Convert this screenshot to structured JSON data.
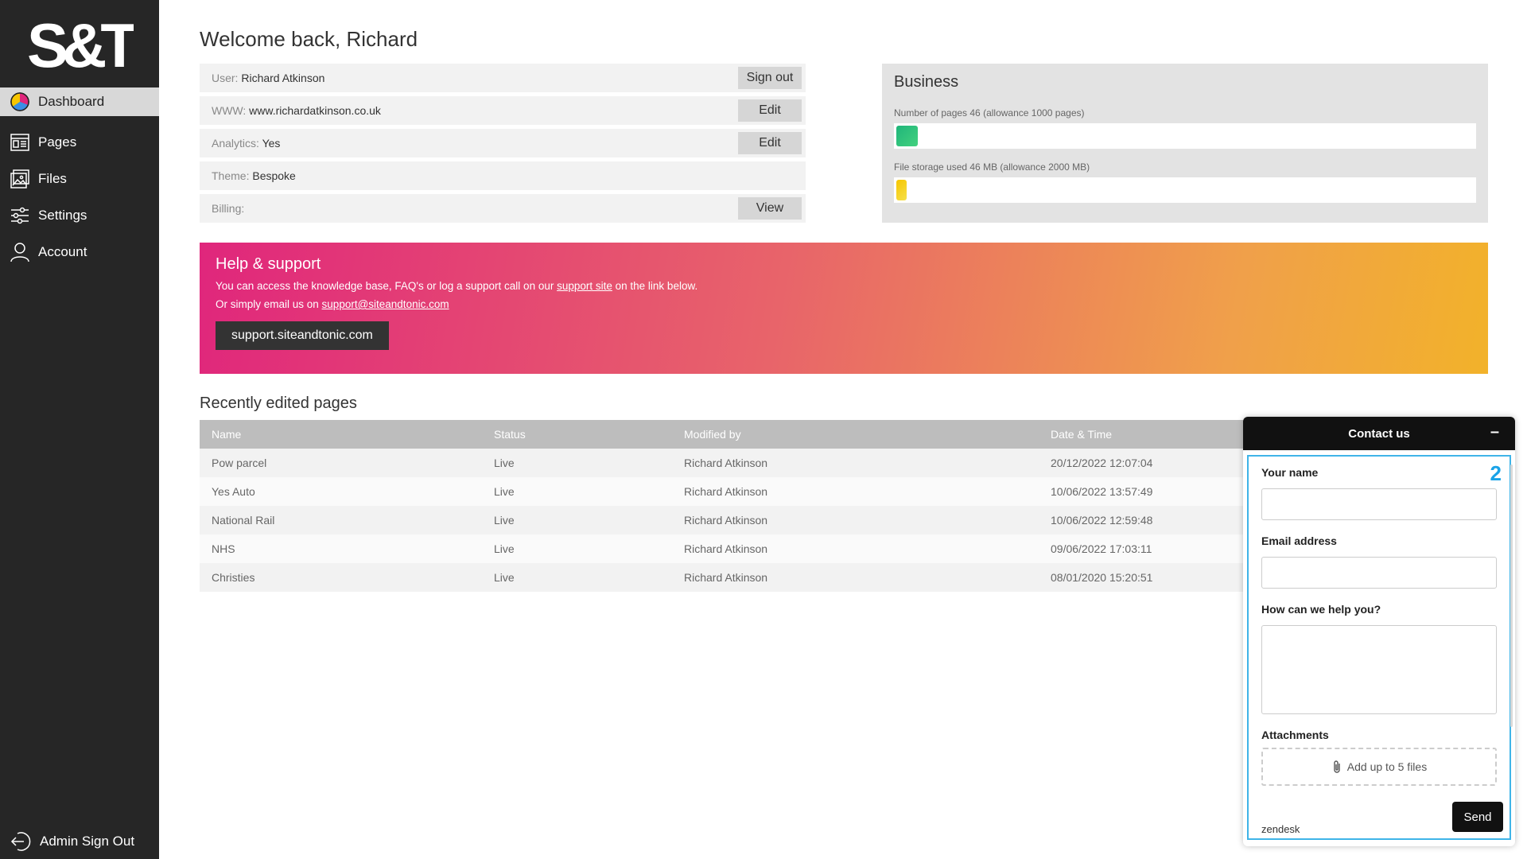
{
  "sidebar": {
    "logo_text": "S&T",
    "items": [
      {
        "label": "Dashboard",
        "icon": "dashboard-icon"
      },
      {
        "label": "Pages",
        "icon": "pages-icon"
      },
      {
        "label": "Files",
        "icon": "files-icon"
      },
      {
        "label": "Settings",
        "icon": "settings-icon"
      },
      {
        "label": "Account",
        "icon": "account-icon"
      }
    ],
    "admin_sign_out": "Admin Sign Out"
  },
  "main": {
    "welcome": "Welcome back, Richard",
    "info": [
      {
        "label": "User:",
        "value": "Richard Atkinson",
        "button": "Sign out"
      },
      {
        "label": "WWW:",
        "value": "www.richardatkinson.co.uk",
        "button": "Edit"
      },
      {
        "label": "Analytics:",
        "value": "Yes",
        "button": "Edit"
      },
      {
        "label": "Theme:",
        "value": "Bespoke",
        "button": ""
      },
      {
        "label": "Billing:",
        "value": "",
        "button": "View"
      }
    ],
    "business": {
      "title": "Business",
      "pages_usage": "Number of pages 46 (allowance 1000 pages)",
      "pages_fraction": 0.046,
      "storage_usage": "File storage used 46 MB (allowance 2000 MB)",
      "storage_fraction": 0.023
    },
    "help": {
      "title": "Help & support",
      "line1_pre": "You can access the knowledge base, FAQ's or log a support call on our ",
      "line1_link": "support site",
      "line1_post": " on the link below.",
      "line2_pre": "Or simply email us on ",
      "line2_link": "support@siteandtonic.com",
      "button": "support.siteandtonic.com"
    },
    "recent": {
      "title": "Recently edited pages",
      "columns": [
        "Name",
        "Status",
        "Modified by",
        "Date & Time"
      ],
      "rows": [
        [
          "Pow parcel",
          "Live",
          "Richard Atkinson",
          "20/12/2022 12:07:04"
        ],
        [
          "Yes Auto",
          "Live",
          "Richard Atkinson",
          "10/06/2022 13:57:49"
        ],
        [
          "National Rail",
          "Live",
          "Richard Atkinson",
          "10/06/2022 12:59:48"
        ],
        [
          "NHS",
          "Live",
          "Richard Atkinson",
          "09/06/2022 17:03:11"
        ],
        [
          "Christies",
          "Live",
          "Richard Atkinson",
          "08/01/2020 15:20:51"
        ]
      ]
    }
  },
  "contact": {
    "title": "Contact us",
    "minimize": "–",
    "step": "2",
    "name_label": "Your name",
    "email_label": "Email address",
    "help_label": "How can we help you?",
    "attachments_label": "Attachments",
    "attach_text": "Add up to 5 files",
    "brand": "zendesk",
    "send": "Send"
  },
  "colors": {
    "sidebar_bg": "#262626",
    "accent_blue": "#3fb4e8",
    "help_gradient_start": "#e0267c",
    "help_gradient_end": "#f2b22a",
    "pages_bar": "#2ec27e",
    "storage_bar": "#f7c600"
  }
}
